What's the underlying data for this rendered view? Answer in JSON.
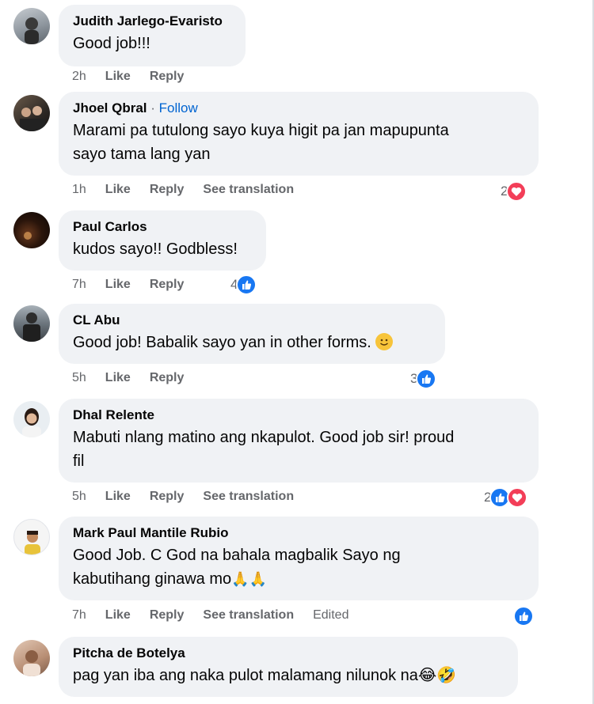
{
  "comments": [
    {
      "author": "Judith Jarlego-Evaristo",
      "text": "Good job!!!",
      "time": "2h",
      "like": "Like",
      "reply": "Reply"
    },
    {
      "author": "Jhoel Qbral",
      "follow_sep": " · ",
      "follow": "Follow",
      "line1": "Marami pa tutulong sayo kuya higit pa jan mapupunta",
      "line2": "sayo tama lang yan",
      "time": "1h",
      "like": "Like",
      "reply": "Reply",
      "translate": "See translation",
      "reaction_count": "2"
    },
    {
      "author": "Paul Carlos",
      "text": "kudos sayo!! Godbless!",
      "time": "7h",
      "like": "Like",
      "reply": "Reply",
      "reaction_count": "4"
    },
    {
      "author": "CL Abu",
      "text": "Good job! Babalik sayo yan in other forms.",
      "time": "5h",
      "like": "Like",
      "reply": "Reply",
      "reaction_count": "3"
    },
    {
      "author": "Dhal Relente",
      "line1": "Mabuti nlang matino ang nkapulot. Good job sir! proud",
      "line2": "fil",
      "time": "5h",
      "like": "Like",
      "reply": "Reply",
      "translate": "See translation",
      "reaction_count": "2"
    },
    {
      "author": "Mark Paul Mantile Rubio",
      "line1": "Good Job. C God na bahala magbalik Sayo ng",
      "line2": "kabutihang ginawa mo",
      "time": "7h",
      "like": "Like",
      "reply": "Reply",
      "translate": "See translation",
      "edited": "Edited"
    },
    {
      "author": "Pitcha de Botelya",
      "text": "pag yan iba ang naka pulot malamang nilunok na"
    }
  ],
  "colors": {
    "bubble": "#f0f2f5",
    "meta": "#65676b",
    "link": "#0064d1",
    "like": "#1877f2",
    "love": "#f33e58"
  },
  "icons": [
    "like-reaction-icon",
    "love-reaction-icon",
    "smile-emoji-icon",
    "pray-emoji-icon",
    "laughing-emoji-icon",
    "rofl-emoji-icon"
  ]
}
